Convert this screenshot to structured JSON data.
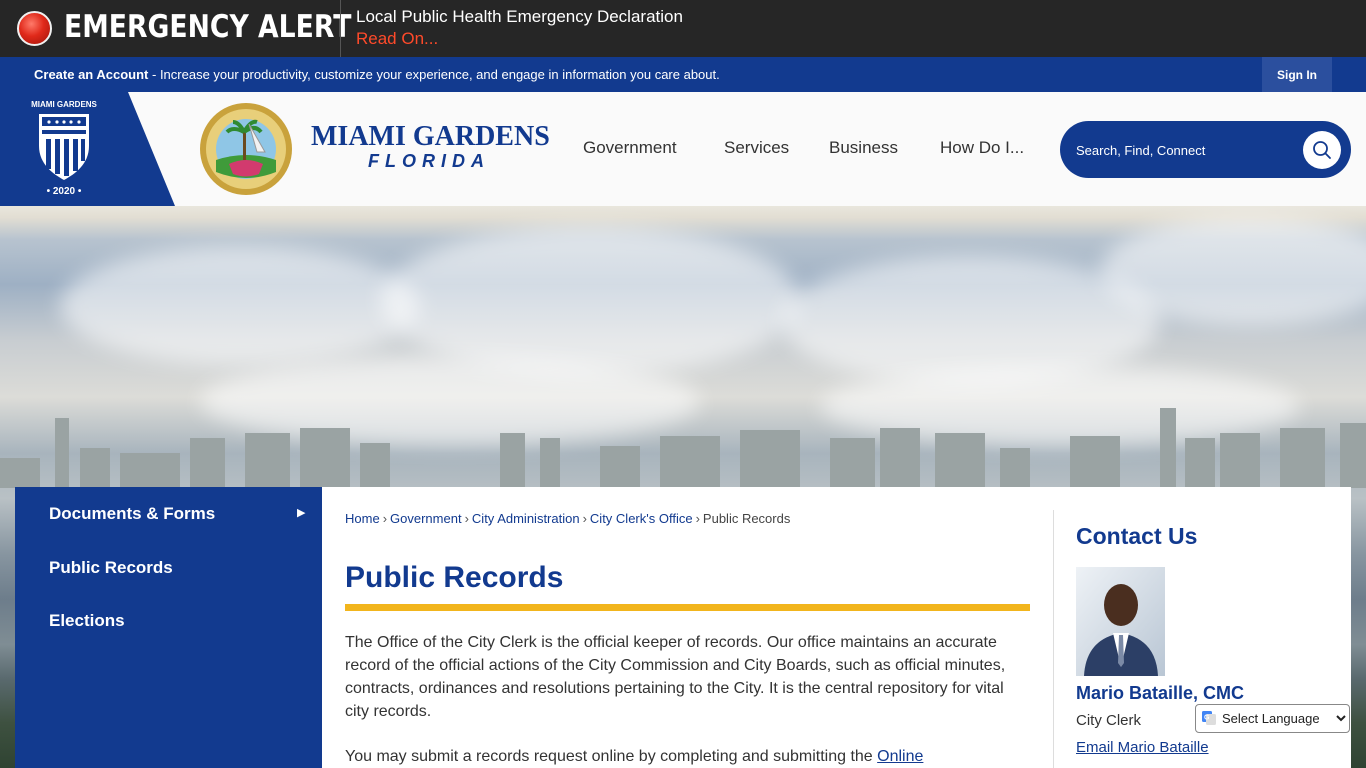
{
  "alert": {
    "title": "EMERGENCY ALERT",
    "headline": "Local Public Health Emergency Declaration",
    "link": "Read On..."
  },
  "account": {
    "create_label": "Create an Account",
    "tagline": " - Increase your productivity, customize your experience, and engage in information you care about.",
    "signin_label": "Sign In"
  },
  "branding": {
    "aac_top": "MIAMI GARDENS",
    "aac_year": "• 2020 •",
    "logo_title": "MIAMI GARDENS",
    "logo_sub": "FLORIDA"
  },
  "nav": {
    "items": [
      "Government",
      "Services",
      "Business",
      "How Do I..."
    ]
  },
  "search": {
    "placeholder": "Search, Find, Connect"
  },
  "sidebar": {
    "items": [
      "Documents & Forms",
      "Public Records",
      "Elections"
    ]
  },
  "breadcrumb": {
    "items": [
      "Home",
      "Government",
      "City Administration",
      "City Clerk's Office"
    ],
    "current": "Public Records"
  },
  "page": {
    "title": "Public Records",
    "paragraph1": "The Office of the City Clerk is the official keeper of records. Our office maintains an accurate record of the official actions of the City Commission and City Boards, such as official minutes, contracts, ordinances and resolutions pertaining to the City. It is the central repository for vital city records.",
    "paragraph2_text": "You may submit a records request online by completing and submitting the ",
    "paragraph2_link": "Online"
  },
  "contact": {
    "title": "Contact Us",
    "name": "Mario Bataille, CMC",
    "role": "City Clerk",
    "email_label": "Email Mario Bataille"
  },
  "language": {
    "selected": "Select Language"
  },
  "colors": {
    "brand_blue": "#123a8f",
    "accent_gold": "#f2b51d",
    "alert_red": "#ff4a2a",
    "alert_bg": "#262626"
  }
}
